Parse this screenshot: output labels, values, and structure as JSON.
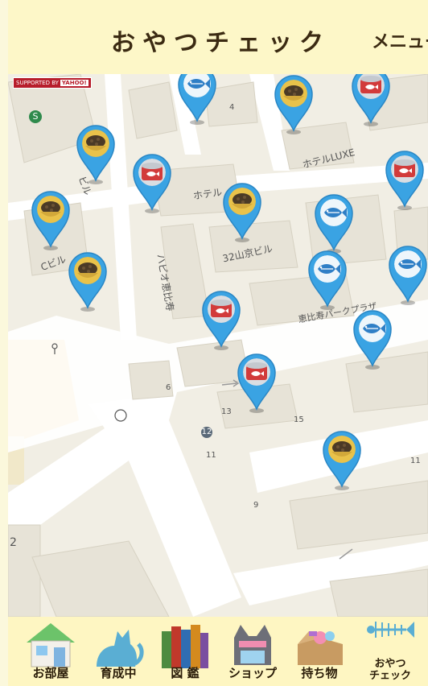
{
  "header": {
    "title": "おやつチェック",
    "menu_label": "メニュー"
  },
  "map": {
    "credit": "SUPPORTED BY",
    "credit_brand": "YAHOO!",
    "labels": [
      "Cビル",
      "ホテルLUXE",
      "32山京ビル",
      "ハピオ恵比寿",
      "恵比寿パークプラザ",
      "ホテル",
      "ビル",
      "2",
      "11",
      "9",
      "6",
      "13",
      "15",
      "4",
      "12",
      "P",
      "S"
    ],
    "pins": [
      {
        "type": "fish"
      },
      {
        "type": "bowl"
      },
      {
        "type": "can"
      },
      {
        "type": "bowl"
      },
      {
        "type": "can"
      },
      {
        "type": "can"
      },
      {
        "type": "bowl"
      },
      {
        "type": "bowl"
      },
      {
        "type": "fish"
      },
      {
        "type": "bowl"
      },
      {
        "type": "fish"
      },
      {
        "type": "fish"
      },
      {
        "type": "can"
      },
      {
        "type": "fish"
      },
      {
        "type": "can"
      },
      {
        "type": "bowl"
      }
    ]
  },
  "nav": {
    "items": [
      {
        "label": "お部屋",
        "icon": "house-icon"
      },
      {
        "label": "育成中",
        "icon": "cat-icon"
      },
      {
        "label": "図 鑑",
        "icon": "books-icon"
      },
      {
        "label": "ショップ",
        "icon": "shop-icon"
      },
      {
        "label": "持ち物",
        "icon": "box-icon"
      },
      {
        "label_line1": "おやつ",
        "label_line2": "チェック",
        "icon": "fishbone-icon"
      }
    ]
  },
  "colors": {
    "pin": "#3aa3e3",
    "header_bg": "#fdf7c8",
    "nav_bg": "#fef6c2",
    "map_bg": "#f2efe6"
  }
}
